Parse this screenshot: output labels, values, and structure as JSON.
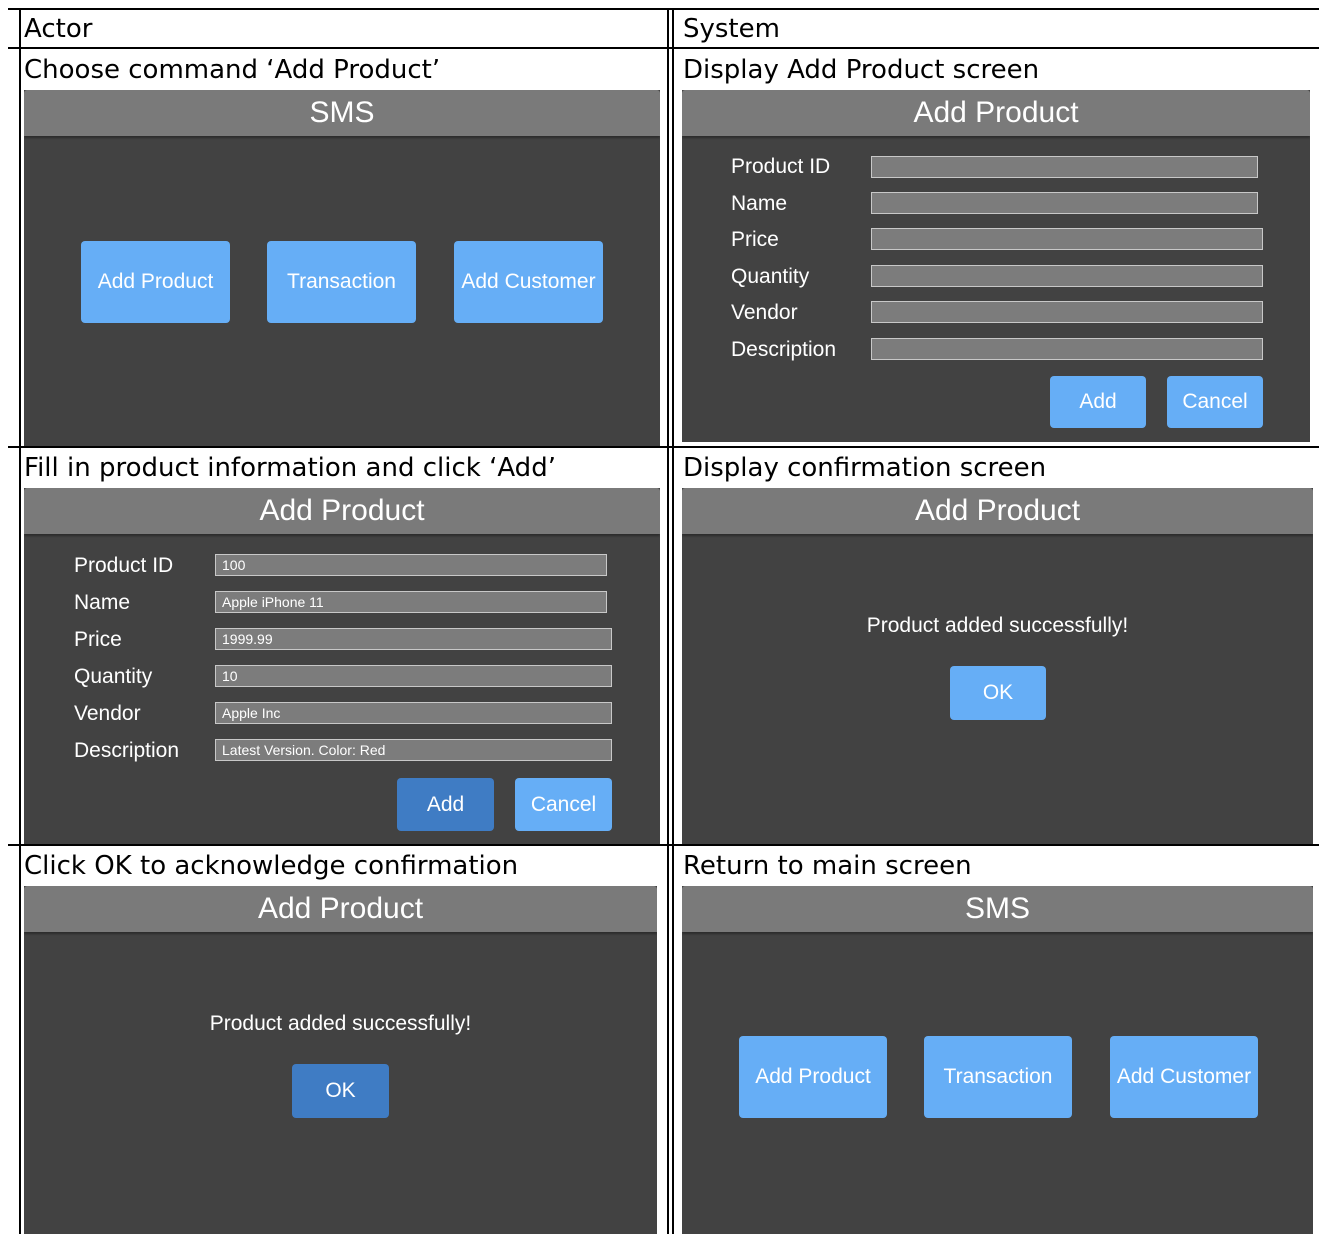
{
  "table": {
    "header_actor": "Actor",
    "header_system": "System",
    "rows": [
      {
        "actor_step": "Choose command ‘Add Product’",
        "system_step": "Display Add Product screen"
      },
      {
        "actor_step": "Fill in product information and click ‘Add’",
        "system_step": "Display confirmation screen"
      },
      {
        "actor_step": "Click OK to acknowledge confirmation",
        "system_step": "Return to main screen"
      }
    ]
  },
  "main_screen": {
    "title": "SMS",
    "buttons": [
      "Add Product",
      "Transaction",
      "Add Customer"
    ]
  },
  "add_product_form": {
    "title": "Add Product",
    "labels": [
      "Product ID",
      "Name",
      "Price",
      "Quantity",
      "Vendor",
      "Description"
    ],
    "add_label": "Add",
    "cancel_label": "Cancel"
  },
  "filled_form": {
    "values": [
      "100",
      "Apple iPhone 11",
      "1999.99",
      "10",
      "Apple Inc",
      "Latest Version. Color: Red"
    ]
  },
  "confirmation": {
    "title": "Add Product",
    "message": "Product added successfully!",
    "ok_label": "OK"
  },
  "colors": {
    "panel_bg": "#424242",
    "titlebar_bg": "#7a7a7a",
    "button_blue": "#66aef6",
    "button_pressed": "#3f7cc4",
    "field_bg": "#7c7c7c"
  }
}
